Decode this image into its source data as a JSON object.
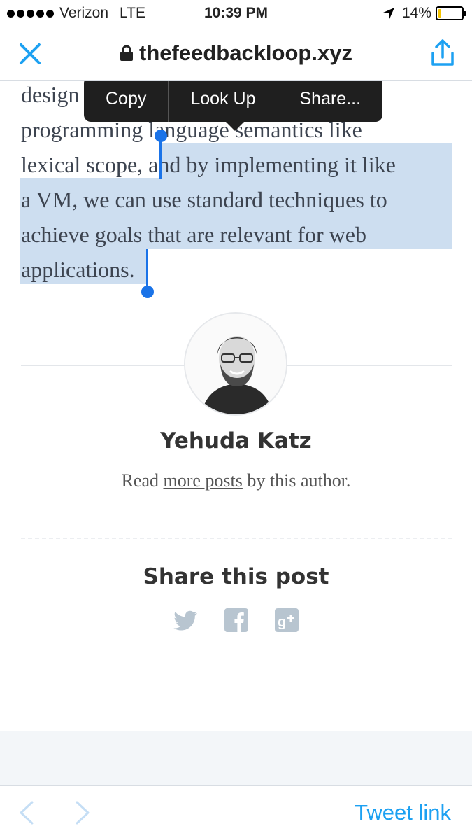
{
  "status_bar": {
    "carrier": "Verizon",
    "network": "LTE",
    "time": "10:39 PM",
    "battery": "14%",
    "battery_level": 0.14
  },
  "nav": {
    "url": "thefeedbackloop.xyz",
    "close_icon": "close-icon",
    "share_icon": "share-icon"
  },
  "context_menu": {
    "items": [
      "Copy",
      "Look Up",
      "Share..."
    ]
  },
  "article": {
    "lines": [
      "design",
      "programming language semantics like",
      "lexical scope, and by implementing it like",
      "a VM, we can use standard techniques to",
      "achieve goals that are relevant for web",
      "applications."
    ]
  },
  "author": {
    "name": "Yehuda Katz",
    "read_prefix": "Read ",
    "more_posts": "more posts",
    "read_suffix": " by this author."
  },
  "share": {
    "title": "Share this post",
    "icons": [
      "twitter-icon",
      "facebook-icon",
      "google-plus-icon"
    ]
  },
  "toolbar": {
    "back_icon": "chevron-left-icon",
    "forward_icon": "chevron-right-icon",
    "tweet_link": "Tweet link"
  },
  "colors": {
    "accent": "#1da1f2",
    "selection": "#cddef0",
    "handle": "#1a73e8"
  }
}
